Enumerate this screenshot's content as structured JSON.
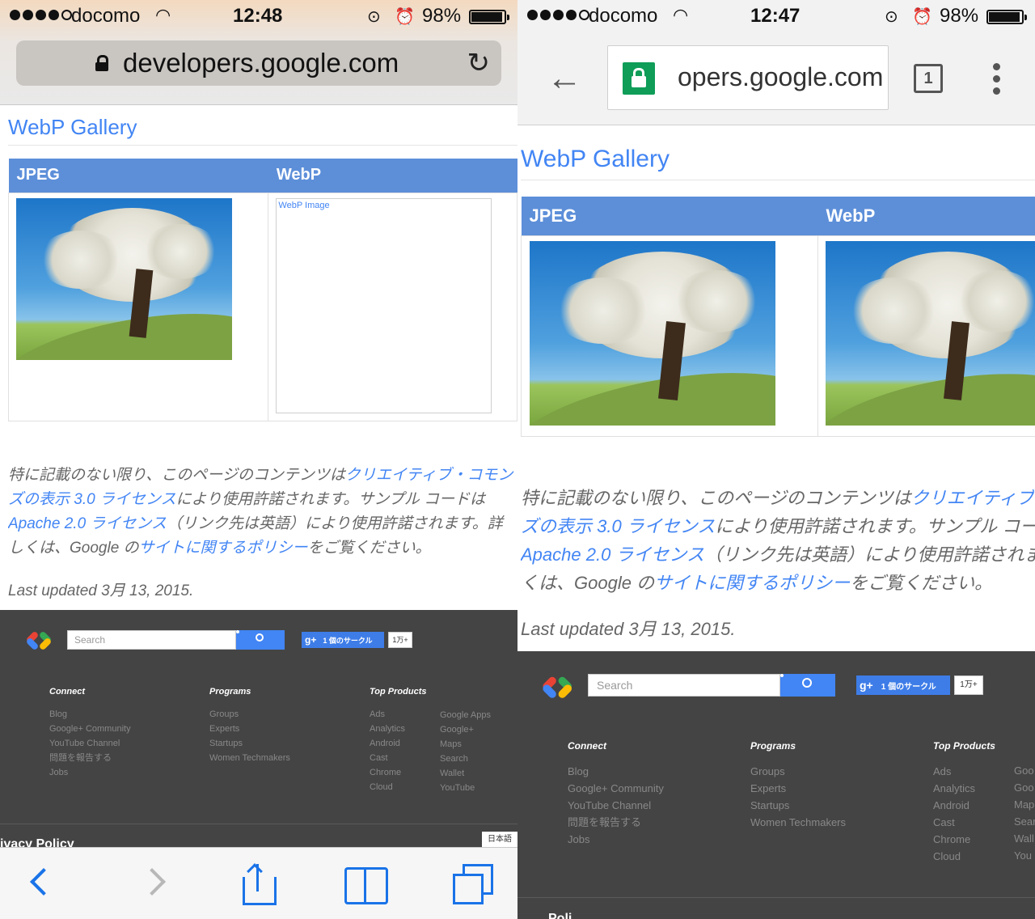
{
  "safari": {
    "status": {
      "carrier": "docomo",
      "time": "12:48",
      "battery": "98%"
    },
    "url": "developers.google.com",
    "page_title": "WebP Gallery",
    "table": {
      "headers": [
        "JPEG",
        "WebP"
      ],
      "broken_image_alt": "WebP Image"
    },
    "license": {
      "t1": "特に記載のない限り、このページのコンテンツは",
      "l1": "クリエイティブ・コモンズの表示 3.0 ライセンス",
      "t2": "により使用許諾されます。サンプル コードは",
      "l2": "Apache 2.0 ライセンス",
      "t3": "（リンク先は英語）により使用許諾されます。詳しくは、Google の",
      "l3": "サイトに関するポリシー",
      "t4": "をご覧ください。"
    },
    "updated": "Last updated 3月 13, 2015.",
    "footer": {
      "search_placeholder": "Search",
      "gplus_label": "1 個のサークル",
      "gplus_count": "1万+",
      "columns": [
        {
          "title": "Connect",
          "items": [
            "Blog",
            "Google+ Community",
            "YouTube Channel",
            "問題を報告する",
            "Jobs"
          ]
        },
        {
          "title": "Programs",
          "items": [
            "Groups",
            "Experts",
            "Startups",
            "Women Techmakers"
          ]
        },
        {
          "title": "Top Products",
          "items": [
            "Ads",
            "Analytics",
            "Android",
            "Cast",
            "Chrome",
            "Cloud"
          ]
        },
        {
          "title": "",
          "items": [
            "Google Apps",
            "Google+",
            "Maps",
            "Search",
            "Wallet",
            "YouTube"
          ]
        }
      ],
      "privacy": "ivacy Policy",
      "language": "日本語"
    }
  },
  "chrome": {
    "status": {
      "carrier": "docomo",
      "time": "12:47",
      "battery": "98%"
    },
    "url": "opers.google.com",
    "tab_count": "1",
    "page_title": "WebP Gallery",
    "table": {
      "headers": [
        "JPEG",
        "WebP"
      ]
    },
    "license": {
      "t1": "特に記載のない限り、このページのコンテンツは",
      "l1": "クリエイティブ",
      "l1b": "ズの表示 3.0 ライセンス",
      "t2": "により使用許諾されます。サンプル コー",
      "l2": "Apache 2.0 ライセンス",
      "t3": "（リンク先は英語）により使用許諾されま",
      "t3b": "くは、Google の",
      "l3": "サイトに関するポリシー",
      "t4": "をご覧ください。"
    },
    "updated": "Last updated 3月 13, 2015.",
    "footer": {
      "search_placeholder": "Search",
      "gplus_label": "1 個のサークル",
      "gplus_count": "1万+",
      "columns": [
        {
          "title": "Connect",
          "items": [
            "Blog",
            "Google+ Community",
            "YouTube Channel",
            "問題を報告する",
            "Jobs"
          ]
        },
        {
          "title": "Programs",
          "items": [
            "Groups",
            "Experts",
            "Startups",
            "Women Techmakers"
          ]
        },
        {
          "title": "Top Products",
          "items": [
            "Ads",
            "Analytics",
            "Android",
            "Cast",
            "Chrome",
            "Cloud"
          ]
        },
        {
          "title": "",
          "items": [
            "Goo",
            "Goo",
            "Map",
            "Sear",
            "Wall",
            "You"
          ]
        }
      ],
      "privacy": "Poli"
    }
  },
  "colors": {
    "link": "#4285f4",
    "table_header": "#5d8fd9",
    "footer_bg": "#444444",
    "chrome_secure": "#0f9d58"
  }
}
